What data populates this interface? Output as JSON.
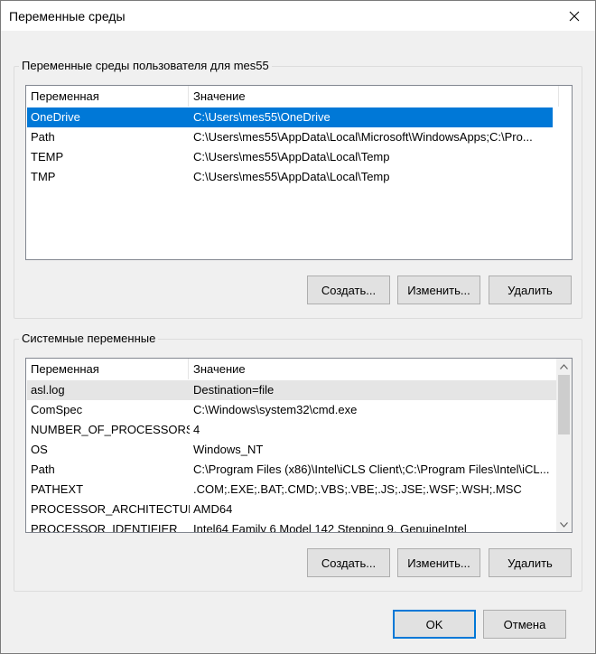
{
  "window": {
    "title": "Переменные среды"
  },
  "user_group": {
    "legend": "Переменные среды пользователя для mes55",
    "columns": [
      "Переменная",
      "Значение"
    ],
    "rows": [
      {
        "name": "OneDrive",
        "value": "C:\\Users\\mes55\\OneDrive",
        "selected": true
      },
      {
        "name": "Path",
        "value": "C:\\Users\\mes55\\AppData\\Local\\Microsoft\\WindowsApps;C:\\Pro..."
      },
      {
        "name": "TEMP",
        "value": "C:\\Users\\mes55\\AppData\\Local\\Temp"
      },
      {
        "name": "TMP",
        "value": "C:\\Users\\mes55\\AppData\\Local\\Temp"
      }
    ],
    "buttons": {
      "new": "Создать...",
      "edit": "Изменить...",
      "delete": "Удалить"
    }
  },
  "system_group": {
    "legend": "Системные переменные",
    "columns": [
      "Переменная",
      "Значение"
    ],
    "rows": [
      {
        "name": "asl.log",
        "value": "Destination=file"
      },
      {
        "name": "ComSpec",
        "value": "C:\\Windows\\system32\\cmd.exe"
      },
      {
        "name": "NUMBER_OF_PROCESSORS",
        "value": "4"
      },
      {
        "name": "OS",
        "value": "Windows_NT"
      },
      {
        "name": "Path",
        "value": "C:\\Program Files (x86)\\Intel\\iCLS Client\\;C:\\Program Files\\Intel\\iCL..."
      },
      {
        "name": "PATHEXT",
        "value": ".COM;.EXE;.BAT;.CMD;.VBS;.VBE;.JS;.JSE;.WSF;.WSH;.MSC"
      },
      {
        "name": "PROCESSOR_ARCHITECTURE",
        "value": "AMD64"
      },
      {
        "name": "PROCESSOR_IDENTIFIER",
        "value": "Intel64 Family 6 Model 142 Stepping 9, GenuineIntel"
      }
    ],
    "buttons": {
      "new": "Создать...",
      "edit": "Изменить...",
      "delete": "Удалить"
    }
  },
  "dialog_buttons": {
    "ok": "OK",
    "cancel": "Отмена"
  },
  "colors": {
    "selection": "#0078d7",
    "soft_selection": "#e5e5e5"
  }
}
